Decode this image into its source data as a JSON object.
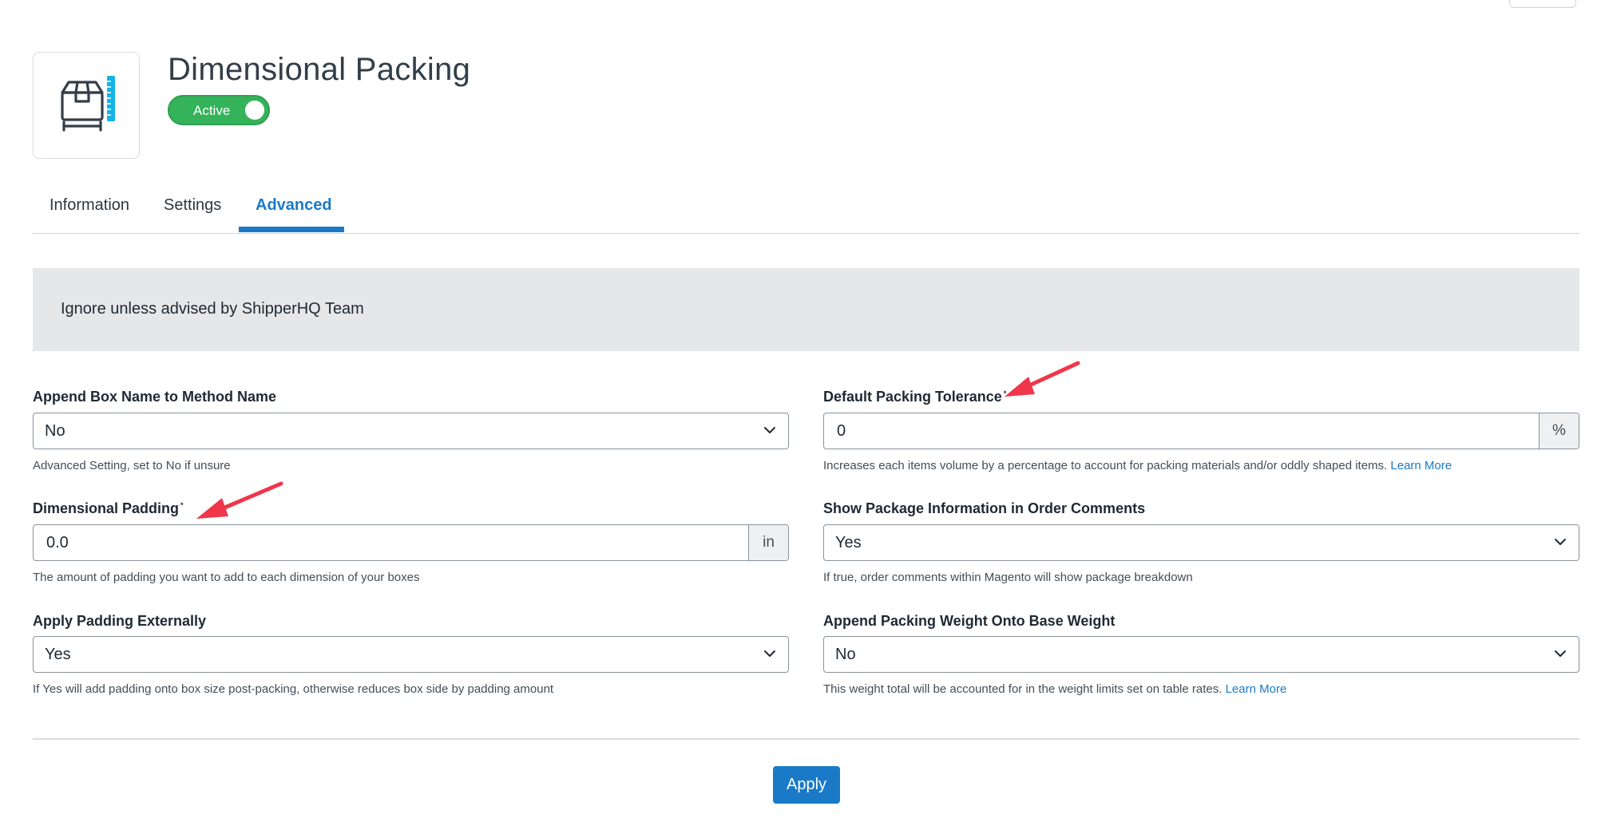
{
  "header": {
    "title": "Dimensional Packing",
    "status_toggle_label": "Active",
    "logo_icon": "box-with-ruler-icon"
  },
  "tabs": [
    {
      "label": "Information",
      "active": false
    },
    {
      "label": "Settings",
      "active": false
    },
    {
      "label": "Advanced",
      "active": true
    }
  ],
  "notice": {
    "text": "Ignore unless advised by ShipperHQ Team"
  },
  "fields": {
    "append_box_name": {
      "label": "Append Box Name to Method Name",
      "value": "No",
      "help": "Advanced Setting, set to No if unsure"
    },
    "default_packing_tolerance": {
      "label": "Default Packing Tolerance",
      "required_mark": "*",
      "value": "0",
      "unit": "%",
      "help": "Increases each items volume by a percentage to account for packing materials and/or oddly shaped items.",
      "help_link": "Learn More"
    },
    "dimensional_padding": {
      "label": "Dimensional Padding",
      "required_mark": "*",
      "value": "0.0",
      "unit": "in",
      "help": "The amount of padding you want to add to each dimension of your boxes"
    },
    "show_package_info": {
      "label": "Show Package Information in Order Comments",
      "value": "Yes",
      "help": "If true, order comments within Magento will show package breakdown"
    },
    "apply_padding_externally": {
      "label": "Apply Padding Externally",
      "value": "Yes",
      "help": "If Yes will add padding onto box size post-packing, otherwise reduces box side by padding amount"
    },
    "append_packing_weight": {
      "label": "Append Packing Weight Onto Base Weight",
      "value": "No",
      "help": "This weight total will be accounted for in the weight limits set on table rates.",
      "help_link": "Learn More"
    }
  },
  "actions": {
    "apply_label": "Apply"
  },
  "colors": {
    "accent": "#1a7ac7",
    "toggle_active": "#34b35a",
    "annotation_arrow": "#f0364a",
    "notice_background": "#e6e7e8"
  }
}
